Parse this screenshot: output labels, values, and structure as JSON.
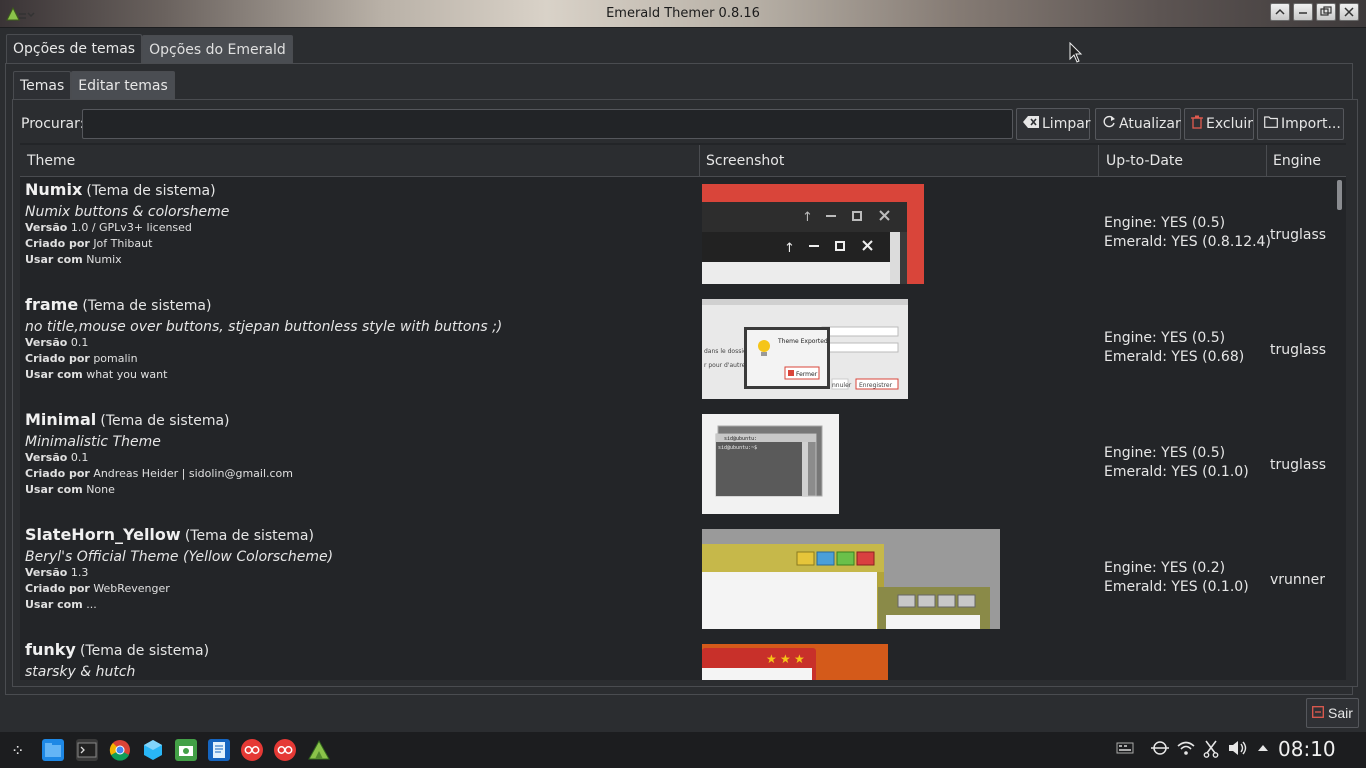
{
  "window": {
    "title": "Emerald Themer 0.8.16"
  },
  "outer_tabs": [
    {
      "label": "Opções de temas",
      "active": true
    },
    {
      "label": "Opções do Emerald",
      "active": false
    }
  ],
  "inner_tabs": [
    {
      "label": "Temas",
      "active": true
    },
    {
      "label": "Editar temas",
      "active": false
    }
  ],
  "search": {
    "label": "Procurar:",
    "value": ""
  },
  "toolbar": {
    "clear_label": "Limpar",
    "refresh_label": "Atualizar",
    "delete_label": "Excluir",
    "import_label": "Import..."
  },
  "table": {
    "columns": [
      "Theme",
      "Screenshot",
      "Up-to-Date",
      "Engine"
    ],
    "rows": [
      {
        "name": "Numix",
        "system_tag": "(Tema de sistema)",
        "description": "Numix buttons & colorsheme",
        "version_label": "Versão",
        "version": "1.0 / GPLv3+ licensed",
        "author_label": "Criado por",
        "author": "Jof Thibaut",
        "use_label": "Usar com",
        "use_with": "Numix",
        "engine_status": "Engine: YES (0.5)",
        "emerald_status": "Emerald: YES (0.8.12.4)",
        "engine": "truglass"
      },
      {
        "name": "frame",
        "system_tag": "(Tema de sistema)",
        "description": "no title,mouse over buttons, stjepan buttonless style with buttons ;)",
        "version_label": "Versão",
        "version": "0.1",
        "author_label": "Criado por",
        "author": "pomalin",
        "use_label": "Usar com",
        "use_with": "what you want",
        "engine_status": "Engine: YES (0.5)",
        "emerald_status": "Emerald: YES (0.68)",
        "engine": "truglass",
        "shot_texts": {
          "exported": "Theme Exported",
          "close": "Fermer",
          "dir": "dans le dossier",
          "others": "r pour d'autres",
          "cancel": "nnuler",
          "save": "Enregistrer"
        }
      },
      {
        "name": "Minimal",
        "system_tag": "(Tema de sistema)",
        "description": "Minimalistic Theme",
        "version_label": "Versão",
        "version": "0.1",
        "author_label": "Criado por",
        "author": "Andreas Heider | sidolin@gmail.com",
        "use_label": "Usar com",
        "use_with": "None",
        "engine_status": "Engine: YES (0.5)",
        "emerald_status": "Emerald: YES (0.1.0)",
        "engine": "truglass",
        "shot_texts": {
          "term_title": "sid@ubuntu:",
          "prompt": "sid@ubuntu:~$"
        }
      },
      {
        "name": "SlateHorn_Yellow",
        "system_tag": "(Tema de sistema)",
        "description": "Beryl's Official Theme (Yellow Colorscheme)",
        "version_label": "Versão",
        "version": "1.3",
        "author_label": "Criado por",
        "author": "WebRevenger",
        "use_label": "Usar com",
        "use_with": "...",
        "engine_status": "Engine: YES (0.2)",
        "emerald_status": "Emerald: YES (0.1.0)",
        "engine": "vrunner"
      },
      {
        "name": "funky",
        "system_tag": "(Tema de sistema)",
        "description": "starsky & hutch"
      }
    ]
  },
  "exit_button": {
    "label": "Sair"
  },
  "taskbar": {
    "clock": "08:10",
    "apps": [
      "app-launcher-icon",
      "file-manager-icon",
      "terminal-icon",
      "chrome-icon",
      "box-icon",
      "screenshot-icon",
      "document-icon",
      "flickr-icon",
      "flickr-icon",
      "emerald-icon"
    ],
    "tray": [
      "keyboard-icon",
      "network-icon",
      "wifi-icon",
      "cut-icon",
      "volume-icon",
      "tray-up-icon"
    ]
  },
  "colors": {
    "background": "#2b2d30",
    "table_bg": "#232528",
    "accent_red": "#d9453a",
    "text": "#e6e6e6"
  }
}
